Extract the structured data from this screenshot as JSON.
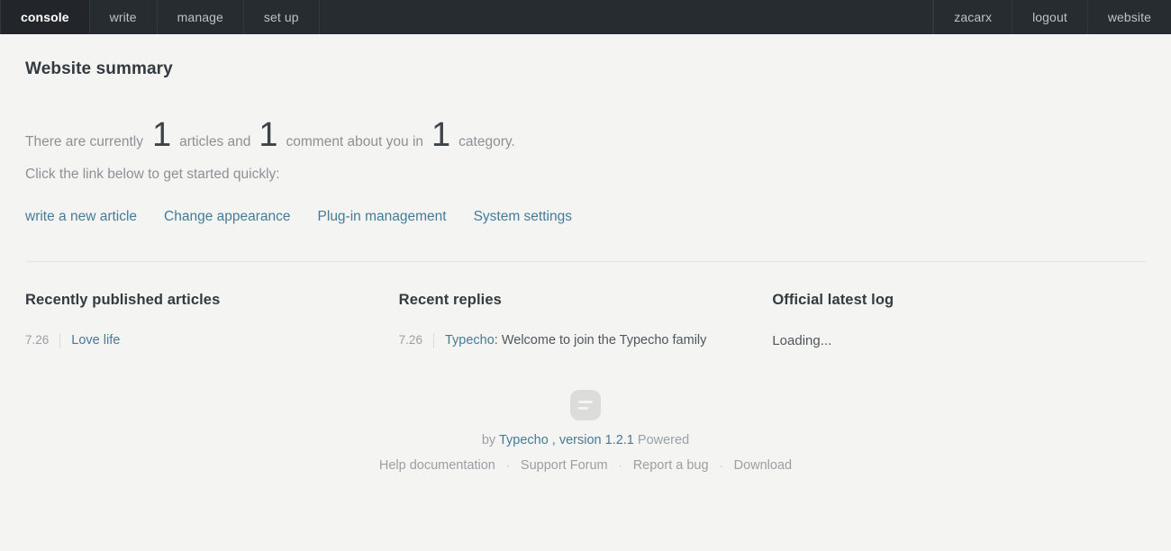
{
  "navbar": {
    "left_items": [
      {
        "label": "console",
        "active": true
      },
      {
        "label": "write",
        "active": false
      },
      {
        "label": "manage",
        "active": false
      },
      {
        "label": "set up",
        "active": false
      }
    ],
    "right_items": [
      {
        "label": "zacarx"
      },
      {
        "label": "logout"
      },
      {
        "label": "website"
      }
    ]
  },
  "page": {
    "title": "Website summary",
    "summary": {
      "prefix": "There are currently",
      "article_count": "1",
      "middle1": "articles and",
      "comment_count": "1",
      "middle2": "comment about you in",
      "category_count": "1",
      "suffix": "category."
    },
    "subtitle": "Click the link below to get started quickly:",
    "quicklinks": [
      {
        "label": "write a new article"
      },
      {
        "label": "Change appearance"
      },
      {
        "label": "Plug-in management"
      },
      {
        "label": "System settings"
      }
    ]
  },
  "columns": {
    "articles": {
      "title": "Recently published articles",
      "items": [
        {
          "date": "7.26",
          "link": "Love life"
        }
      ]
    },
    "replies": {
      "title": "Recent replies",
      "items": [
        {
          "date": "7.26",
          "author": "Typecho",
          "text": ": Welcome to join the Typecho family"
        }
      ]
    },
    "log": {
      "title": "Official latest log",
      "status": "Loading..."
    }
  },
  "footer": {
    "logo_icon": "typecho-logo-icon",
    "credit_prefix": "by",
    "credit_link": "Typecho , version 1.2.1",
    "credit_suffix": "Powered",
    "links": [
      {
        "label": "Help documentation"
      },
      {
        "label": "Support Forum"
      },
      {
        "label": "Report a bug"
      },
      {
        "label": "Download"
      }
    ],
    "dot": "·"
  }
}
